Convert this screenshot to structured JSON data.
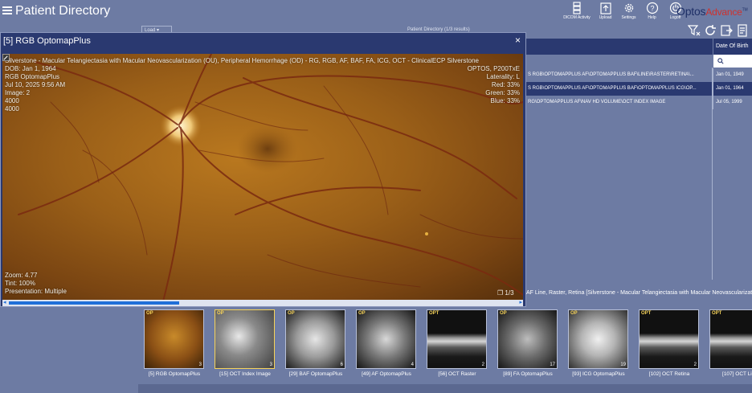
{
  "app": {
    "title": "Patient Directory"
  },
  "top_tools": [
    {
      "name": "dicom-activity-button",
      "label": "DICOM Activity",
      "icon": "server-icon"
    },
    {
      "name": "upload-button",
      "label": "Upload",
      "icon": "upload-icon"
    },
    {
      "name": "settings-button",
      "label": "Settings",
      "icon": "gear-icon"
    },
    {
      "name": "help-button",
      "label": "Help",
      "icon": "help-icon"
    },
    {
      "name": "logoff-button",
      "label": "Logoff",
      "icon": "power-icon"
    }
  ],
  "brand": {
    "optos": "Optos",
    "advance": "Advance",
    "tm": "TM"
  },
  "directory": {
    "load_label": "Load",
    "results_text": "Patient Directory (1/3 results)",
    "dob_header": "Date Of Birth",
    "rows": [
      {
        "desc": "S RGB\\OPTOMAPPLUS AF\\OPTOMAPPLUS BAF\\LINE\\RASTER\\RETINA\\...",
        "dob": "Jan 01, 1949",
        "selected": false
      },
      {
        "desc": "S RGB\\OPTOMAPPLUS AF\\OPTOMAPPLUS BAF\\OPTOMAPPLUS ICG\\OP...",
        "dob": "Jan 01, 1964",
        "selected": true
      },
      {
        "desc": "RG\\OPTOMAPPLUS AF\\NAV HD VOLUME\\OCT INDEX IMAGE",
        "dob": "Jul 05, 1999",
        "selected": false
      }
    ],
    "strip_header": "AF Line, Raster, Retina [Silverstone - Macular Telangiectasia with Macular Neovascularization"
  },
  "viewer": {
    "title": "[5] RGB OptomapPlus",
    "close": "×",
    "overlay_left": [
      "Silverstone - Macular Telangiectasia with Macular Neovascularization (OU), Peripheral Hemorrhage (OD) - RG, RGB, AF, BAF, FA, ICG, OCT - ClinicalECP Silverstone",
      "DOB: Jan 1, 1964",
      "RGB OptomapPlus",
      "Jul 10, 2025 9:56 AM",
      "Image: 2",
      "4000",
      "4000"
    ],
    "overlay_right": [
      "OPTOS, P200TxE",
      "Laterality: L",
      "Red: 33%",
      "Green: 33%",
      "Blue: 33%"
    ],
    "overlay_bottom": [
      "Zoom: 4.77",
      "Tint: 100%",
      "Presentation: Multiple"
    ],
    "pager": "1/3"
  },
  "thumbnails": [
    {
      "tag": "OP",
      "count": "3",
      "caption": "[5] RGB OptomapPlus",
      "style": "rgb"
    },
    {
      "tag": "OP",
      "count": "3",
      "caption": "[15] OCT Index Image",
      "style": "gray"
    },
    {
      "tag": "OP",
      "count": "6",
      "caption": "[29] BAF OptomapPlus",
      "style": "baf"
    },
    {
      "tag": "OP",
      "count": "4",
      "caption": "[49] AF OptomapPlus",
      "style": "af"
    },
    {
      "tag": "OPT",
      "count": "2",
      "caption": "[56] OCT Raster",
      "style": "oct"
    },
    {
      "tag": "OP",
      "count": "17",
      "caption": "[89] FA OptomapPlus",
      "style": "fa"
    },
    {
      "tag": "OP",
      "count": "19",
      "caption": "[93] ICG OptomapPlus",
      "style": "icg"
    },
    {
      "tag": "OPT",
      "count": "2",
      "caption": "[102] OCT Retina",
      "style": "oct"
    },
    {
      "tag": "OPT",
      "count": "",
      "caption": "[107] OCT Line",
      "style": "oct"
    }
  ]
}
